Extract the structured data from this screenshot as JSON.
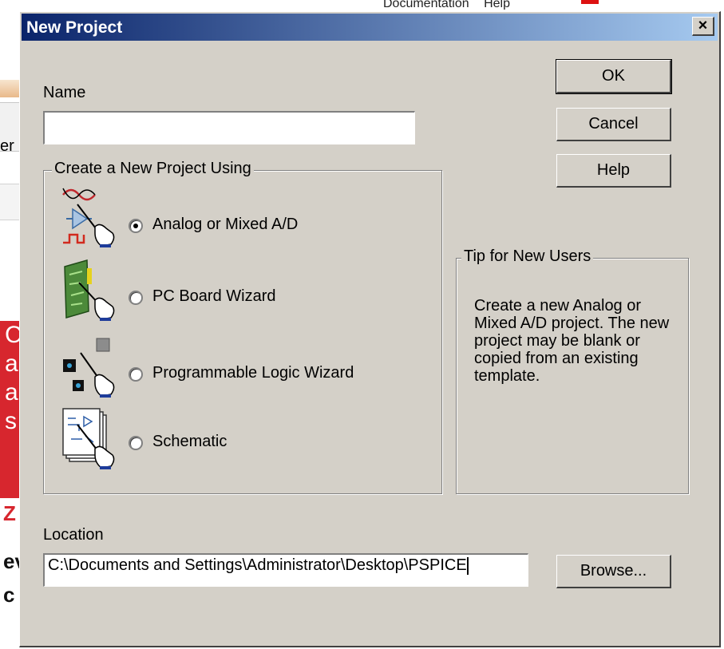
{
  "background": {
    "menu": [
      "Documentation",
      "Help"
    ],
    "fragments": [
      "er",
      "C",
      "a",
      "a",
      "s",
      "Z",
      "ev",
      "c"
    ]
  },
  "dialog": {
    "title": "New Project",
    "close_symbol": "×",
    "name_label": "Name",
    "name_value": "",
    "create_group_title": "Create a New Project Using",
    "options": [
      {
        "label": "Analog or Mixed A/D",
        "checked": true,
        "icon": "analog-mixed-icon"
      },
      {
        "label": "PC Board Wizard",
        "checked": false,
        "icon": "pc-board-icon"
      },
      {
        "label": "Programmable Logic Wizard",
        "checked": false,
        "icon": "programmable-logic-icon"
      },
      {
        "label": "Schematic",
        "checked": false,
        "icon": "schematic-icon"
      }
    ],
    "tip_group_title": "Tip for New Users",
    "tip_text": "Create a new Analog or Mixed A/D project.  The new project may be blank or copied from an existing template.",
    "location_label": "Location",
    "location_value": "C:\\Documents and Settings\\Administrator\\Desktop\\PSPICE",
    "buttons": {
      "ok": "OK",
      "cancel": "Cancel",
      "help": "Help",
      "browse": "Browse..."
    }
  },
  "colors": {
    "dialog_bg": "#d4d0c8",
    "title_start": "#0a246a",
    "title_end": "#a6caf0",
    "bg_red": "#d7262e"
  }
}
